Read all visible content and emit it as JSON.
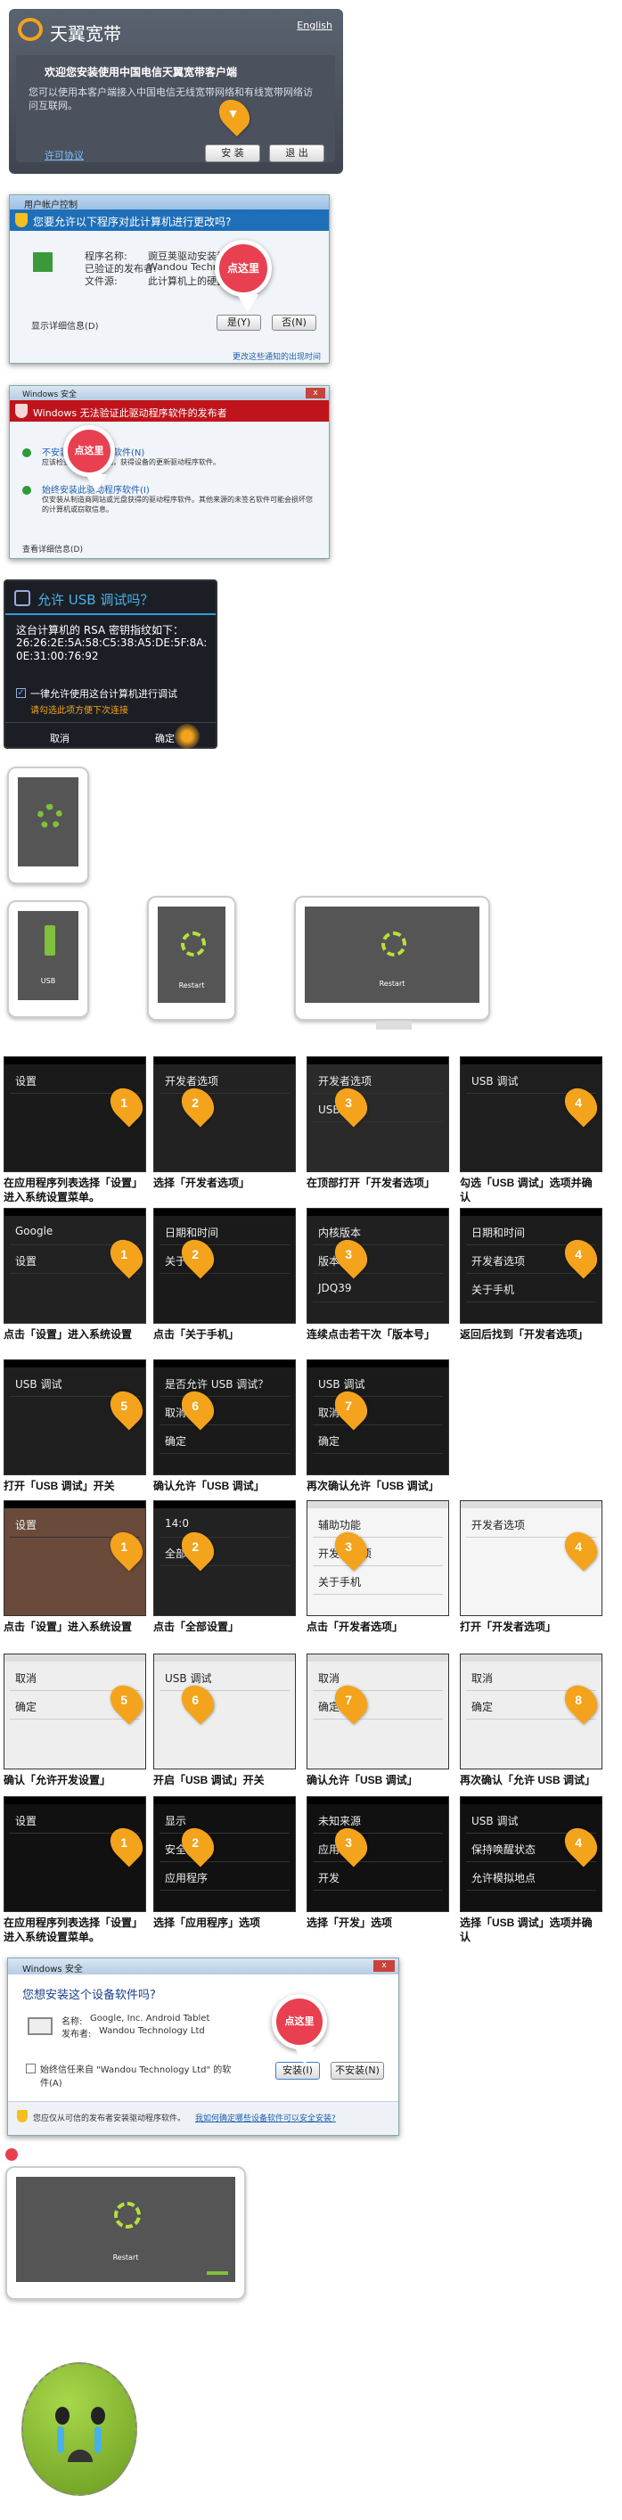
{
  "installer": {
    "brand": "天翼宽带",
    "lang_link": "English",
    "welcome": "欢迎您安装使用中国电信天翼宽带客户端",
    "body": "您可以使用本客户端接入中国电信无线宽带网络和有线宽带网络访问互联网。",
    "license_link": "许可协议",
    "install_button": "安 装",
    "exit_button": "退 出"
  },
  "uac": {
    "title": "用户帐户控制",
    "question": "您要允许以下程序对此计算机进行更改吗?",
    "program_name_label": "程序名称:",
    "program_name": "豌豆荚驱动安装程序",
    "publisher_label": "已验证的发布者:",
    "publisher": "Wandou Technol...",
    "origin_label": "文件源:",
    "origin": "此计算机上的硬盘驱动器",
    "details": "显示详细信息(D)",
    "yes_button": "是(Y)",
    "no_button": "否(N)",
    "settings_link": "更改这些通知的出现时间",
    "tap_here": "点这里"
  },
  "winsec": {
    "title": "Windows 安全",
    "header": "Windows 无法验证此驱动程序软件的发布者",
    "opt1_title": "不安装此驱动程序软件(N)",
    "opt1_desc": "应该检查制造商的网站，获得设备的更新驱动程序软件。",
    "opt2_title": "始终安装此驱动程序软件(I)",
    "opt2_desc": "仅安装从制造商网站或光盘获得的驱动程序软件。其他来源的未签名软件可能会损坏您的计算机或窃取信息。",
    "details": "查看详细信息(D)",
    "tap_here": "点这里"
  },
  "usbdebug": {
    "title": "允许 USB 调试吗？",
    "fingerprint_label": "这台计算机的 RSA 密钥指纹如下：",
    "fingerprint": "26:26:2E:5A:58:C5:38:A5:DE:5F:8A:0E:31:00:76:92",
    "always_allow": "一律允许使用这台计算机进行调试",
    "warning": "请勾选此项方便下次连接",
    "cancel_button": "取消",
    "ok_button": "确定"
  },
  "phones": {
    "usb_label": "USB",
    "restart_label": "Restart"
  },
  "rows": [
    {
      "caps": [
        "在应用程序列表选择「设置」进入系统设置菜单。",
        "选择「开发者选项」",
        "在顶部打开「开发者选项」",
        "勾选「USB 调试」选项并确认"
      ],
      "nums": [
        "1",
        "2",
        "3",
        "4"
      ]
    },
    {
      "caps": [
        "点击「设置」进入系统设置",
        "点击「关于手机」",
        "连续点击若干次「版本号」",
        "返回后找到「开发者选项」"
      ],
      "nums": [
        "1",
        "2",
        "3",
        "4"
      ]
    },
    {
      "caps": [
        "打开「USB 调试」开关",
        "确认允许「USB 调试」",
        "再次确认允许「USB 调试」"
      ],
      "nums": [
        "5",
        "6",
        "7"
      ]
    },
    {
      "caps": [
        "点击「设置」进入系统设置",
        "点击「全部设置」",
        "点击「开发者选项」",
        "打开「开发者选项」"
      ],
      "nums": [
        "1",
        "2",
        "3",
        "4"
      ]
    },
    {
      "caps": [
        "确认「允许开发设置」",
        "开启「USB 调试」开关",
        "确认允许「USB 调试」",
        "再次确认「允许 USB 调试」"
      ],
      "nums": [
        "5",
        "6",
        "7",
        "8"
      ]
    },
    {
      "caps": [
        "在应用程序列表选择「设置」进入系统设置菜单。",
        "选择「应用程序」选项",
        "选择「开发」选项",
        "选择「USB 调试」选项并确认"
      ],
      "nums": [
        "1",
        "2",
        "3",
        "4"
      ]
    }
  ],
  "screens": {
    "dev_options": "开发者选项",
    "usb_debugging": "USB 调试",
    "about_phone": "关于手机",
    "date_time": "日期和时间",
    "version": "版本号",
    "kernel": "内核版本",
    "all_settings": "全部设置",
    "accessibility": "辅助功能",
    "allow_usb_debug_q": "是否允许 USB 调试？",
    "display": "显示",
    "apps": "应用程序",
    "security": "安全",
    "unknown_sources": "未知来源",
    "dev": "开发",
    "stay_awake": "保持唤醒状态",
    "mock_location": "允许模拟地点",
    "cancel": "取消",
    "ok": "确定",
    "time": "14:0",
    "google": "Google",
    "settings": "设置",
    "build": "JDQ39"
  },
  "winsec2": {
    "title": "Windows 安全",
    "question": "您想安装这个设备软件吗?",
    "name_label": "名称:",
    "name": "Google, Inc. Android Tablet",
    "publisher_label": "发布者:",
    "publisher": "Wandou Technology Ltd",
    "trust_label": "始终信任来自 \"Wandou Technology Ltd\" 的软件(A)",
    "install_button": "安装(I)",
    "dont_install_button": "不安装(N)",
    "footer": "您应仅从可信的发布者安装驱动程序软件。",
    "footer_link": "我如何确定哪些设备软件可以安全安装?",
    "tap_here": "点这里"
  },
  "monitor": {
    "restart_label": "Restart"
  }
}
